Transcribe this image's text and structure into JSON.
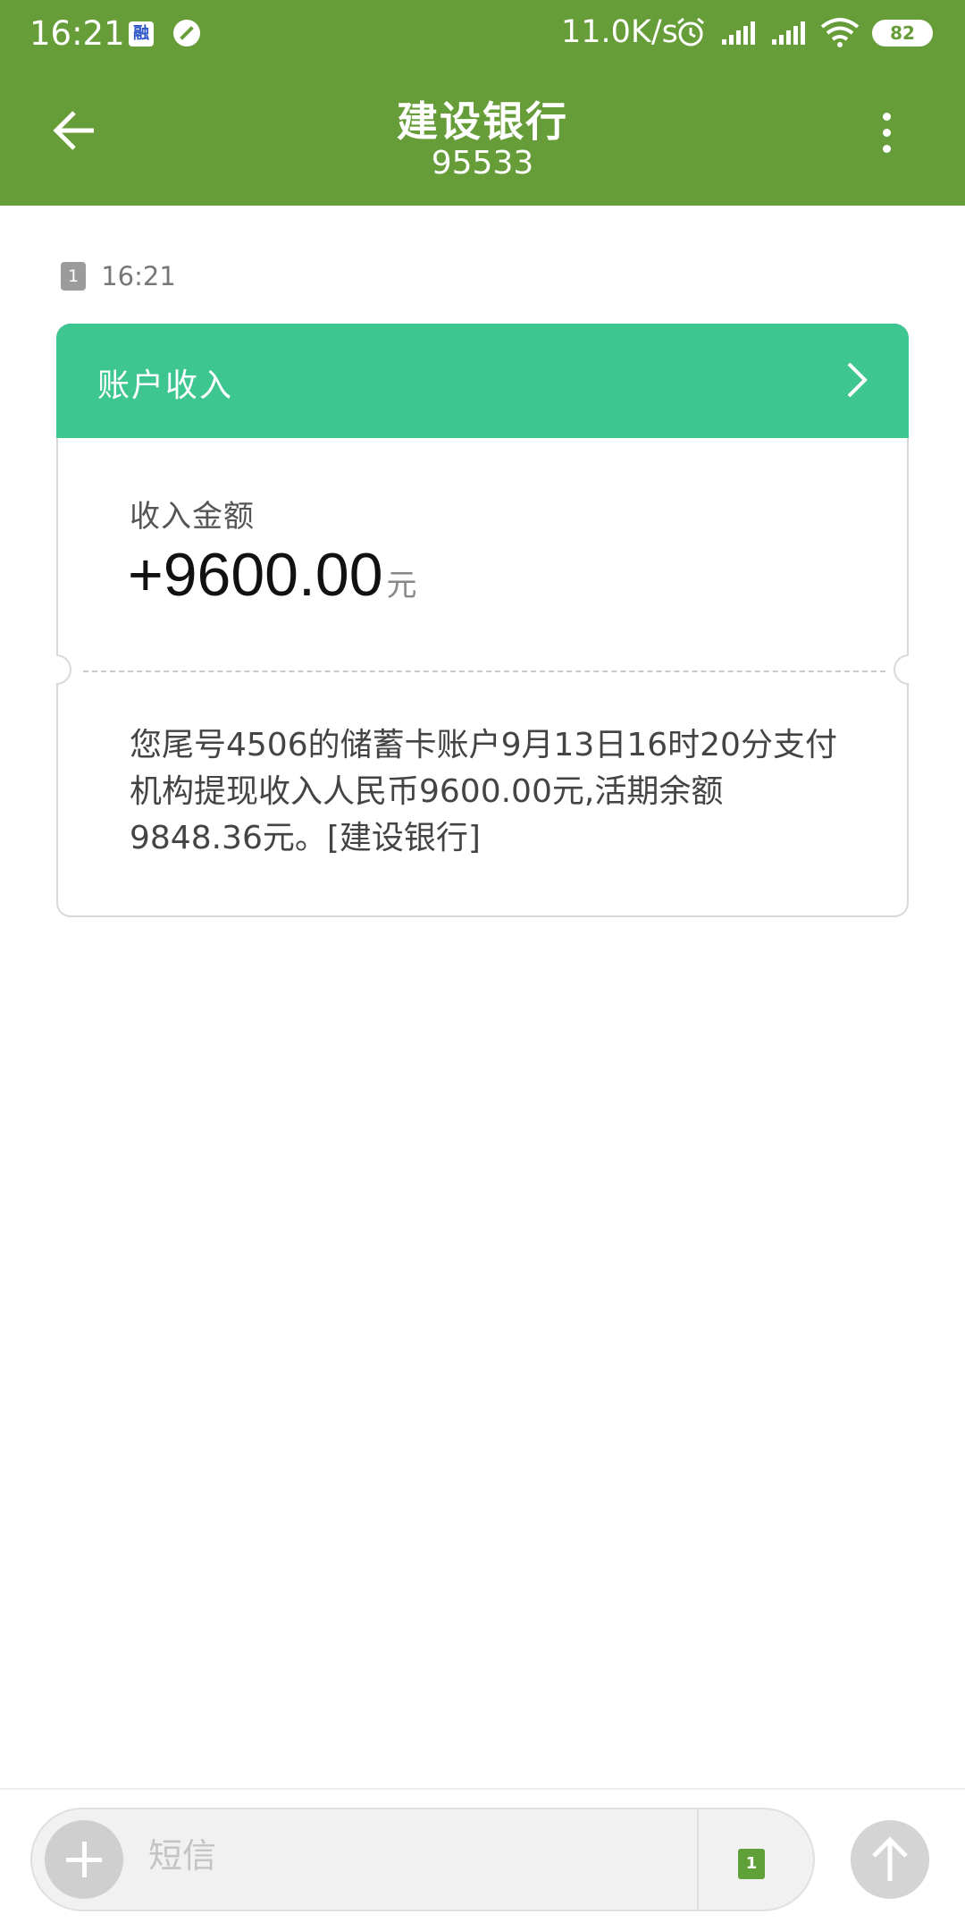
{
  "status_bar": {
    "time": "16:21",
    "app_icon_label": "融",
    "net_speed": "11.0K/s",
    "battery": "82"
  },
  "header": {
    "title": "建设银行",
    "number": "95533"
  },
  "message": {
    "sim": "1",
    "time": "16:21",
    "card_title": "账户收入",
    "amount_label": "收入金额",
    "amount": "+9600.00",
    "amount_unit": "元",
    "body": "您尾号4506的储蓄卡账户9月13日16时20分支付机构提现收入人民币9600.00元,活期余额9848.36元。[建设银行]"
  },
  "compose": {
    "placeholder": "短信",
    "sim": "1"
  },
  "colors": {
    "header_bg": "#669d38",
    "card_header_bg": "#3ec690"
  },
  "icons": [
    "back-arrow-icon",
    "more-vert-icon",
    "chevron-right-icon",
    "plus-icon",
    "send-arrow-up-icon",
    "sim-card-icon",
    "alarm-icon",
    "signal-icon",
    "wifi-icon",
    "battery-icon"
  ]
}
